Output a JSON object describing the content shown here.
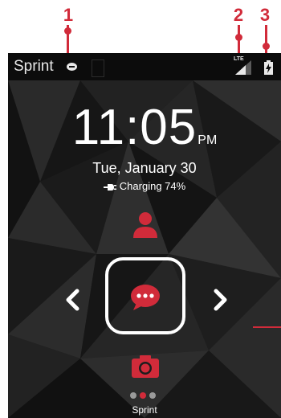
{
  "callouts": [
    {
      "number": "1"
    },
    {
      "number": "2"
    },
    {
      "number": "3"
    }
  ],
  "status_bar": {
    "carrier": "Sprint",
    "network_type": "LTE",
    "icons": [
      "voicemail-icon",
      "signal-icon",
      "battery-charging-icon"
    ]
  },
  "lock_screen": {
    "time": "11:05",
    "ampm": "PM",
    "date": "Tue, January 30",
    "charging_text": "Charging 74%",
    "bottom_carrier": "Sprint",
    "page_count": 3,
    "active_page": 2
  },
  "colors": {
    "accent": "#d12b3a",
    "status_bar": "#0c0c0c",
    "wallpaper_dark": "#1a1a1a",
    "text": "#ffffff"
  },
  "shortcuts": [
    "contact-icon",
    "message-icon",
    "camera-icon"
  ]
}
